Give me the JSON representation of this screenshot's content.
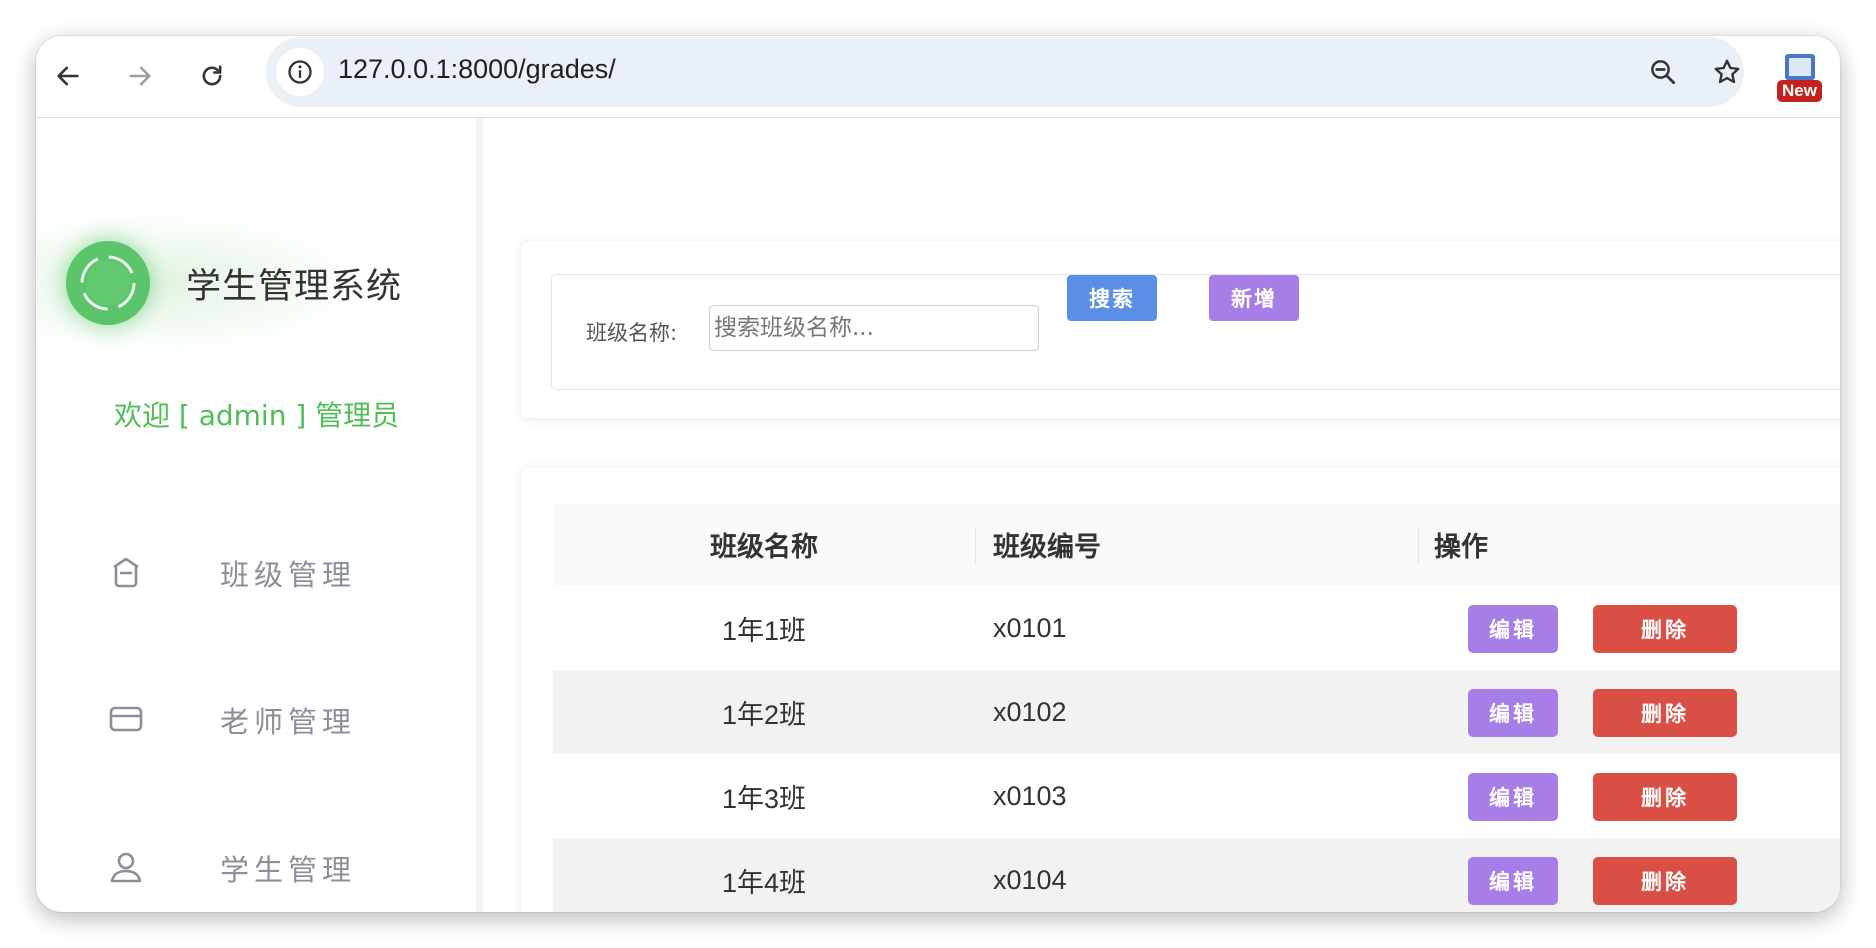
{
  "browser": {
    "url": "127.0.0.1:8000/grades/",
    "extension_badge": "New"
  },
  "sidebar": {
    "brand_title": "学生管理系统",
    "welcome": "欢迎 [ admin ] 管理员",
    "items": [
      {
        "label": "班级管理",
        "icon": "class-home-icon"
      },
      {
        "label": "老师管理",
        "icon": "card-icon"
      },
      {
        "label": "学生管理",
        "icon": "user-icon"
      }
    ]
  },
  "search": {
    "label": "班级名称:",
    "placeholder": "搜索班级名称...",
    "search_button": "搜索",
    "add_button": "新增"
  },
  "table": {
    "headers": [
      "班级名称",
      "班级编号",
      "操作"
    ],
    "rows": [
      {
        "name": "1年1班",
        "code": "x0101"
      },
      {
        "name": "1年2班",
        "code": "x0102"
      },
      {
        "name": "1年3班",
        "code": "x0103"
      },
      {
        "name": "1年4班",
        "code": "x0104"
      }
    ],
    "edit_label": "编辑",
    "delete_label": "删除"
  },
  "colors": {
    "accent_green": "#4fbf54",
    "search_button": "#5b8ee6",
    "add_button": "#a77de8",
    "edit_button": "#a77de8",
    "delete_button": "#d94f45"
  }
}
